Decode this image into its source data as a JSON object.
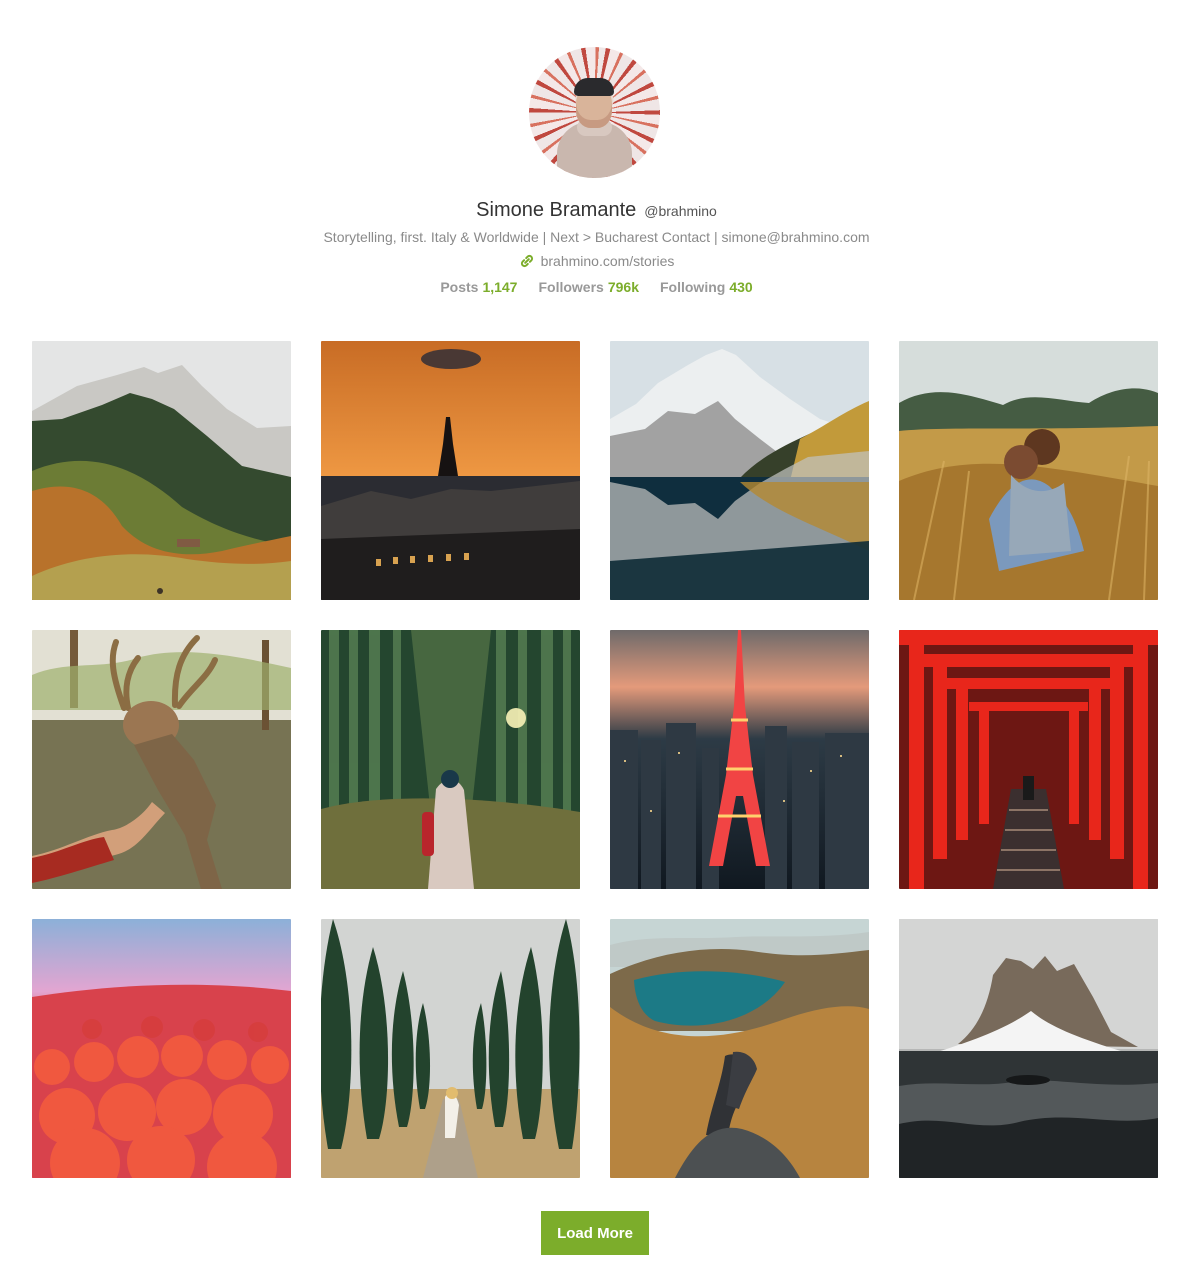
{
  "profile": {
    "name": "Simone Bramante",
    "handle": "@brahmino",
    "bio": "Storytelling, first. Italy & Worldwide | Next > Bucharest Contact | simone@brahmino.com",
    "website": "brahmino.com/stories",
    "stats": [
      {
        "label": "Posts",
        "value": "1,147"
      },
      {
        "label": "Followers",
        "value": "796k"
      },
      {
        "label": "Following",
        "value": "430"
      }
    ]
  },
  "gallery": [
    {
      "name": "autumn-mountain-photo"
    },
    {
      "name": "paris-sunset-eiffel-photo"
    },
    {
      "name": "mountain-lake-reflection-photo"
    },
    {
      "name": "couple-wheat-field-photo"
    },
    {
      "name": "deer-hand-photo"
    },
    {
      "name": "bamboo-forest-photo"
    },
    {
      "name": "tokyo-tower-night-photo"
    },
    {
      "name": "red-torii-gates-photo"
    },
    {
      "name": "red-bushes-field-photo"
    },
    {
      "name": "cypress-road-photo"
    },
    {
      "name": "lake-legs-view-photo"
    },
    {
      "name": "snowy-peak-sea-photo"
    }
  ],
  "actions": {
    "load_more": "Load More"
  },
  "colors": {
    "accent": "#7cad2b",
    "muted": "#8a8a8a",
    "name": "#333333"
  }
}
